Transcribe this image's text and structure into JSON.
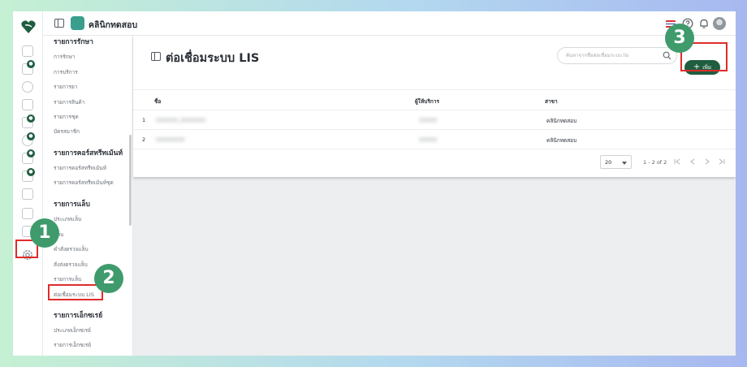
{
  "app": {
    "brand_name": "คลินิกทดสอบ"
  },
  "submenu": {
    "sections": [
      {
        "title": "รายการรักษา",
        "items": [
          "การรักษา",
          "การบริการ",
          "รายการยา",
          "รายการสินค้า",
          "รายการชุด",
          "บัตรสมาชิก"
        ]
      },
      {
        "title": "รายการคอร์สทรีทเม้นท์",
        "items": [
          "รายการคอร์สทรีทเม้นท์",
          "รายการคอร์สทรีทเม้นท์ชุด"
        ]
      },
      {
        "title": "รายการแล็บ",
        "items": [
          "ประเภทแล็บ",
          "แล็บ",
          "คำสั่งตรวจแล็บ",
          "สั่งส่งตรวจแล็บ",
          "รายการแล็บ",
          "ต่อเชื่อมระบบ LIS"
        ]
      },
      {
        "title": "รายการเอ็กซเรย์",
        "items": [
          "ประเภทเอ็กซเรย์",
          "รายการเอ็กซเรย์"
        ]
      }
    ]
  },
  "page": {
    "title": "ต่อเชื่อมระบบ LIS",
    "search_placeholder": "ค้นหาจากชื่อต่อเชื่อมระบบ lis",
    "add_label": "เพิ่ม"
  },
  "table": {
    "columns": [
      "ชื่อ",
      "ผู้ให้บริการ",
      "สาขา"
    ],
    "rows": [
      {
        "index": "1",
        "name": "XXXXXX_XXXXXXX",
        "provider": "XXXXX",
        "branch": "คลินิกทดสอบ"
      },
      {
        "index": "2",
        "name": "XXXXXXXX",
        "provider": "XXXXX",
        "branch": "คลินิกทดสอบ"
      }
    ]
  },
  "pagination": {
    "page_size": "20",
    "range": "1 - 2 of 2"
  },
  "annotations": [
    "1",
    "2",
    "3"
  ],
  "colors": {
    "brand": "#1f5d3f",
    "callout": "#3f9b6c",
    "highlight": "#e02b2b"
  },
  "icons": {
    "logo": "leaf-heart-icon",
    "settings": "gear-icon",
    "search": "search-icon",
    "notifications": "bell-icon",
    "help": "help-icon",
    "language": "thai-flag-icon"
  }
}
